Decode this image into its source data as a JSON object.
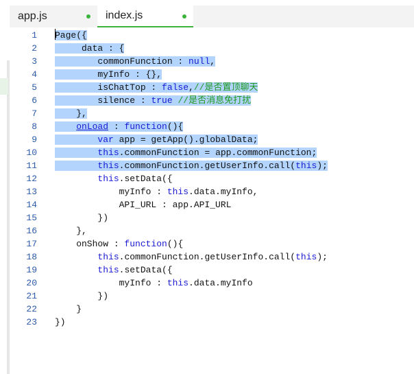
{
  "tabs": [
    {
      "label": "app.js",
      "active": false,
      "modified": true
    },
    {
      "label": "index.js",
      "active": true,
      "modified": true
    }
  ],
  "colors": {
    "keyword": "#1a1ad6",
    "comment": "#1e9a1e",
    "selection": "#b3d4fc",
    "line_number": "#2b5aa8",
    "modified_dot": "#3db33d"
  },
  "editor": {
    "lines": [
      {
        "num": "1",
        "selected": true,
        "tokens": [
          {
            "t": "Page({",
            "c": "plain"
          }
        ]
      },
      {
        "num": "2",
        "selected": true,
        "tokens": [
          {
            "t": "     data : {",
            "c": "plain"
          }
        ]
      },
      {
        "num": "3",
        "selected": true,
        "tokens": [
          {
            "t": "        commonFunction : ",
            "c": "plain"
          },
          {
            "t": "null",
            "c": "kw"
          },
          {
            "t": ",",
            "c": "plain"
          }
        ]
      },
      {
        "num": "4",
        "selected": true,
        "tokens": [
          {
            "t": "        myInfo : {},",
            "c": "plain"
          }
        ]
      },
      {
        "num": "5",
        "selected": true,
        "tokens": [
          {
            "t": "        isChatTop : ",
            "c": "plain"
          },
          {
            "t": "false",
            "c": "kw"
          },
          {
            "t": ",",
            "c": "plain"
          },
          {
            "t": "//是否置顶聊天",
            "c": "cm"
          }
        ]
      },
      {
        "num": "6",
        "selected": true,
        "tokens": [
          {
            "t": "        silence : ",
            "c": "plain"
          },
          {
            "t": "true",
            "c": "kw"
          },
          {
            "t": " ",
            "c": "plain"
          },
          {
            "t": "//是否消息免打扰",
            "c": "cm"
          }
        ]
      },
      {
        "num": "7",
        "selected": true,
        "tokens": [
          {
            "t": "    },",
            "c": "plain"
          }
        ]
      },
      {
        "num": "8",
        "selected": true,
        "tokens": [
          {
            "t": "    ",
            "c": "plain"
          },
          {
            "t": "onLoad",
            "c": "link"
          },
          {
            "t": " : ",
            "c": "plain"
          },
          {
            "t": "function",
            "c": "kw"
          },
          {
            "t": "(){",
            "c": "plain"
          }
        ]
      },
      {
        "num": "9",
        "selected": true,
        "tokens": [
          {
            "t": "        ",
            "c": "plain"
          },
          {
            "t": "var",
            "c": "kw"
          },
          {
            "t": " app = getApp().globalData;",
            "c": "plain"
          }
        ]
      },
      {
        "num": "10",
        "selected": true,
        "tokens": [
          {
            "t": "        ",
            "c": "plain"
          },
          {
            "t": "this",
            "c": "kw"
          },
          {
            "t": ".commonFunction = app.commonFunction;",
            "c": "plain"
          }
        ]
      },
      {
        "num": "11",
        "selected": true,
        "tokens": [
          {
            "t": "        ",
            "c": "plain"
          },
          {
            "t": "this",
            "c": "kw"
          },
          {
            "t": ".commonFunction.getUserInfo.call(",
            "c": "plain"
          },
          {
            "t": "this",
            "c": "kw"
          },
          {
            "t": ");",
            "c": "plain"
          }
        ]
      },
      {
        "num": "12",
        "selected": false,
        "tokens": [
          {
            "t": "        ",
            "c": "plain"
          },
          {
            "t": "this",
            "c": "kw"
          },
          {
            "t": ".setData({",
            "c": "plain"
          }
        ]
      },
      {
        "num": "13",
        "selected": false,
        "tokens": [
          {
            "t": "            myInfo : ",
            "c": "plain"
          },
          {
            "t": "this",
            "c": "kw"
          },
          {
            "t": ".data.myInfo,",
            "c": "plain"
          }
        ]
      },
      {
        "num": "14",
        "selected": false,
        "tokens": [
          {
            "t": "            API_URL : app.API_URL",
            "c": "plain"
          }
        ]
      },
      {
        "num": "15",
        "selected": false,
        "tokens": [
          {
            "t": "        })",
            "c": "plain"
          }
        ]
      },
      {
        "num": "16",
        "selected": false,
        "tokens": [
          {
            "t": "    },",
            "c": "plain"
          }
        ]
      },
      {
        "num": "17",
        "selected": false,
        "tokens": [
          {
            "t": "    onShow : ",
            "c": "plain"
          },
          {
            "t": "function",
            "c": "kw"
          },
          {
            "t": "(){",
            "c": "plain"
          }
        ]
      },
      {
        "num": "18",
        "selected": false,
        "tokens": [
          {
            "t": "        ",
            "c": "plain"
          },
          {
            "t": "this",
            "c": "kw"
          },
          {
            "t": ".commonFunction.getUserInfo.call(",
            "c": "plain"
          },
          {
            "t": "this",
            "c": "kw"
          },
          {
            "t": ");",
            "c": "plain"
          }
        ]
      },
      {
        "num": "19",
        "selected": false,
        "tokens": [
          {
            "t": "        ",
            "c": "plain"
          },
          {
            "t": "this",
            "c": "kw"
          },
          {
            "t": ".setData({",
            "c": "plain"
          }
        ]
      },
      {
        "num": "20",
        "selected": false,
        "tokens": [
          {
            "t": "            myInfo : ",
            "c": "plain"
          },
          {
            "t": "this",
            "c": "kw"
          },
          {
            "t": ".data.myInfo",
            "c": "plain"
          }
        ]
      },
      {
        "num": "21",
        "selected": false,
        "tokens": [
          {
            "t": "        })",
            "c": "plain"
          }
        ]
      },
      {
        "num": "22",
        "selected": false,
        "tokens": [
          {
            "t": "    }",
            "c": "plain"
          }
        ]
      },
      {
        "num": "23",
        "selected": false,
        "tokens": [
          {
            "t": "})",
            "c": "plain"
          }
        ]
      }
    ]
  }
}
